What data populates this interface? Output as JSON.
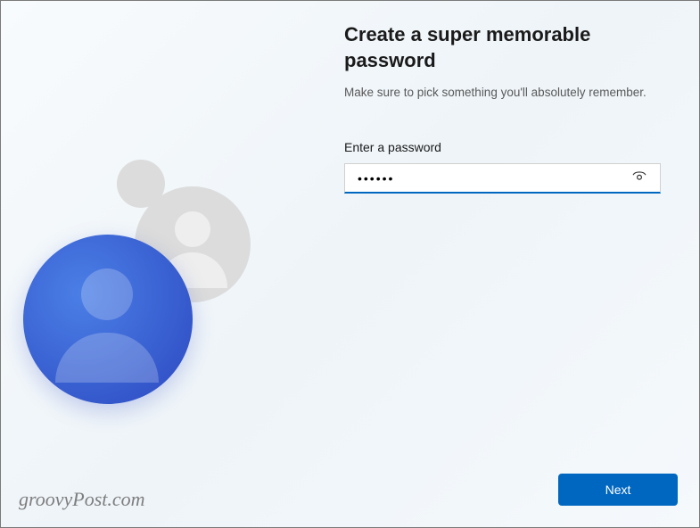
{
  "header": {
    "title": "Create a super memorable password",
    "subtitle": "Make sure to pick something you'll absolutely remember."
  },
  "form": {
    "password_label": "Enter a password",
    "password_value": "••••••",
    "reveal_tooltip": "Show password"
  },
  "actions": {
    "next_label": "Next"
  },
  "watermark": "groovyPost.com"
}
